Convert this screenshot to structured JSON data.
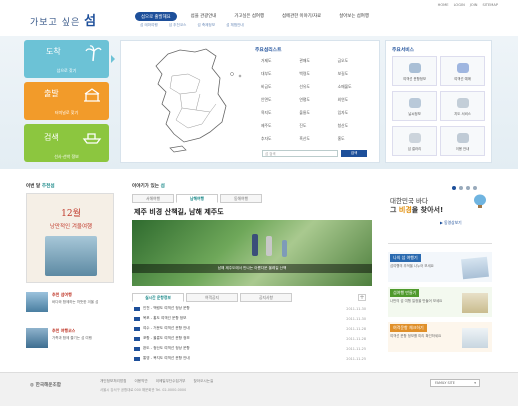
{
  "header": {
    "logo_prefix": "가보고 싶은",
    "logo_main": "섬",
    "top_links": [
      "HOME",
      "LOGIN",
      "JOIN",
      "SITEMAP"
    ],
    "nav": [
      "섬으로 출발해요",
      "섬을 관광안내",
      "가고싶은 섬여행",
      "섬에관한 이야기/자료",
      "살아보는 섬여행"
    ],
    "subnav": [
      "섬 테마여행",
      "섬 추천코스",
      "섬 축제정보",
      "섬 체험안내"
    ]
  },
  "left_buttons": [
    {
      "icon": "도착",
      "label": "섬으로 찾기",
      "color": "#6cc2d6"
    },
    {
      "icon": "출발",
      "label": "터미널로 찾기",
      "color": "#f29b2a"
    },
    {
      "icon": "검색",
      "label": "선사·선박 정보",
      "color": "#8cc63f"
    }
  ],
  "region": {
    "title": "주요섬리스트",
    "items": [
      "거제도",
      "관매도",
      "금오도",
      "대부도",
      "백령도",
      "보길도",
      "비금도",
      "선유도",
      "소매물도",
      "안면도",
      "연평도",
      "외연도",
      "욕지도",
      "울릉도",
      "임자도",
      "제주도",
      "진도",
      "청산도",
      "추자도",
      "흑산도",
      "홍도"
    ],
    "search_placeholder": "섬 검색",
    "search_button": "검색"
  },
  "services": {
    "title": "주요서비스",
    "items": [
      "여객선 운항정보",
      "여객선 예매",
      "날씨정보",
      "지도 서비스",
      "섬 갤러리",
      "이용 안내"
    ]
  },
  "recommend": {
    "title_plain": "이번 달",
    "title_bold": "추천섬",
    "poster_line1": "12월",
    "poster_line2": "낭만적인 겨울여행",
    "items": [
      {
        "title": "추천 섬여행",
        "desc": "바다와 함께하는 따뜻한 겨울 섬"
      },
      {
        "title": "추천 여행코스",
        "desc": "가족과 함께 즐기는 섬 여행"
      }
    ]
  },
  "stories": {
    "title_plain": "이야기가 있는",
    "title_bold": "섬",
    "tabs": [
      "서해여행",
      "남해여행",
      "동해여행"
    ],
    "headline": "제주 비경 산책길, 남해 제주도",
    "caption": "남해 제주도에서 만나는 아름다운 올레길 산책"
  },
  "notices": {
    "tabs": [
      "실시간 운항정보",
      "여객공지",
      "공지사항"
    ],
    "rows": [
      {
        "text": "인천 - 백령도 여객선 정상 운항",
        "date": "2011-11-30"
      },
      {
        "text": "목포 - 홍도 여객선 운항 정보",
        "date": "2011-11-30"
      },
      {
        "text": "여수 - 거문도 여객선 운항 안내",
        "date": "2011-11-28"
      },
      {
        "text": "포항 - 울릉도 여객선 운항 정보",
        "date": "2011-11-28"
      },
      {
        "text": "완도 - 청산도 여객선 정상 운항",
        "date": "2011-11-25"
      },
      {
        "text": "통영 - 욕지도 여객선 운항 안내",
        "date": "2011-11-25"
      }
    ]
  },
  "right": {
    "banner_line1": "대한민국 바다",
    "banner_line2_plain": "그",
    "banner_line2_hl": "비경",
    "banner_line2_end": "을 찾아서!",
    "banner_link": "동영상보기",
    "cards": [
      {
        "title": "나의 섬 여행기",
        "desc": "섬여행의 추억을 나누어 보세요",
        "color": "#2a6ab0"
      },
      {
        "title": "섬여행 만들기",
        "desc": "나만의 섬 여행 일정을 만들어 보세요",
        "color": "#4f9a2c"
      },
      {
        "title": "여객운항 체크하기",
        "desc": "여객선 운항 정보를 미리 확인하세요",
        "color": "#e0902a"
      }
    ]
  },
  "footer": {
    "brand": "한국해운조합",
    "links": [
      "개인정보처리방침",
      "이용약관",
      "이메일무단수집거부",
      "찾아오시는길"
    ],
    "address": "서울시 강서구 공항대로 000 해운회관 Tel. 02-0000-0000",
    "family_site": "FAMILY SITE"
  }
}
